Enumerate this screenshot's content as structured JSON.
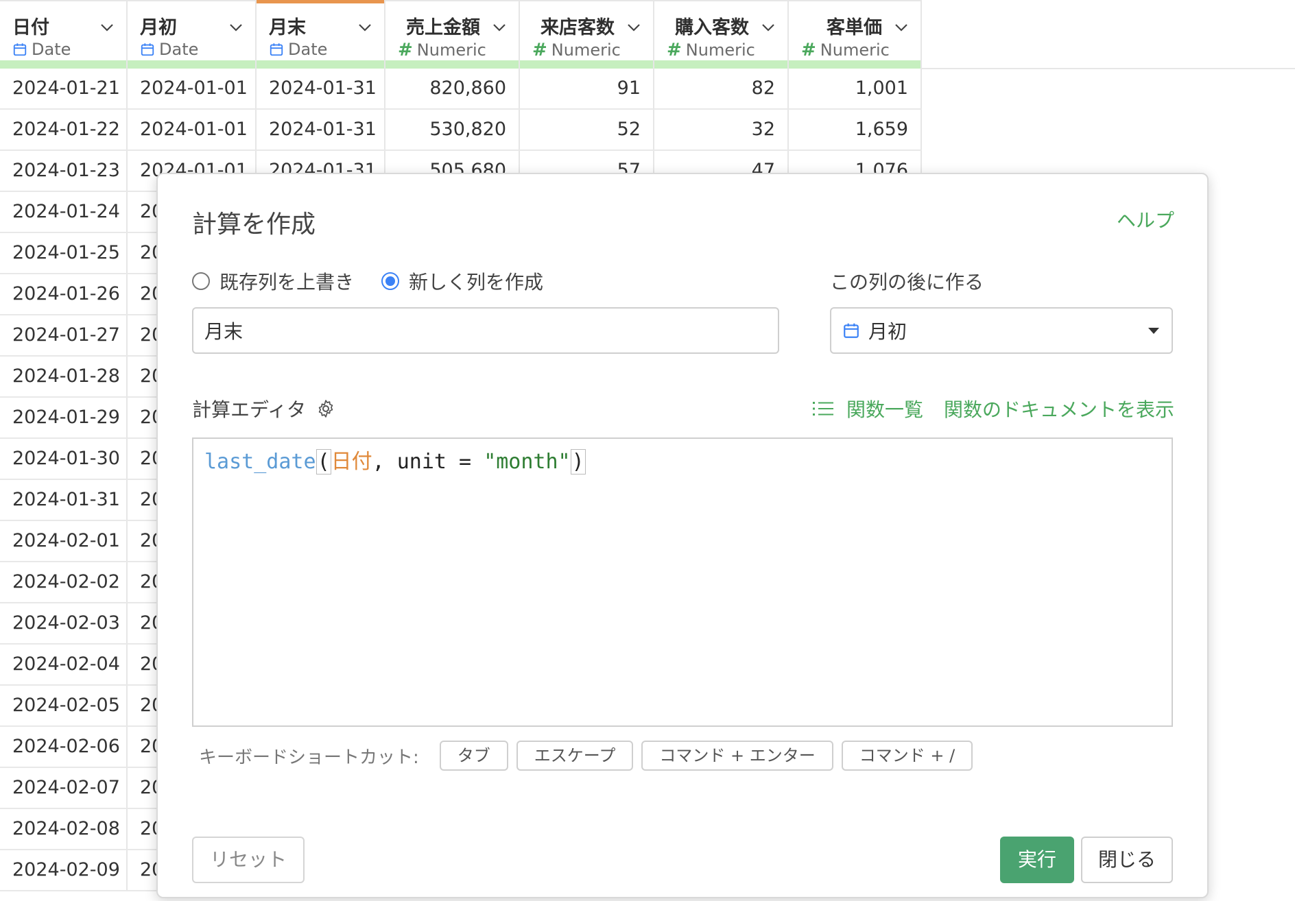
{
  "grid": {
    "columns": [
      {
        "name": "日付",
        "type": "Date",
        "kind": "date",
        "active": false
      },
      {
        "name": "月初",
        "type": "Date",
        "kind": "date",
        "active": false
      },
      {
        "name": "月末",
        "type": "Date",
        "kind": "date",
        "active": true
      },
      {
        "name": "売上金額",
        "type": "Numeric",
        "kind": "numeric",
        "active": false
      },
      {
        "name": "来店客数",
        "type": "Numeric",
        "kind": "numeric",
        "active": false
      },
      {
        "name": "購入客数",
        "type": "Numeric",
        "kind": "numeric",
        "active": false
      },
      {
        "name": "客単価",
        "type": "Numeric",
        "kind": "numeric",
        "active": false
      }
    ],
    "rows": [
      [
        "2024-01-21",
        "2024-01-01",
        "2024-01-31",
        "820,860",
        "91",
        "82",
        "1,001"
      ],
      [
        "2024-01-22",
        "2024-01-01",
        "2024-01-31",
        "530,820",
        "52",
        "32",
        "1,659"
      ],
      [
        "2024-01-23",
        "2024-01-01",
        "2024-01-31",
        "505,680",
        "57",
        "47",
        "1,076"
      ],
      [
        "2024-01-24",
        "20",
        "",
        "",
        "",
        "",
        ""
      ],
      [
        "2024-01-25",
        "20",
        "",
        "",
        "",
        "",
        ""
      ],
      [
        "2024-01-26",
        "20",
        "",
        "",
        "",
        "",
        ""
      ],
      [
        "2024-01-27",
        "20",
        "",
        "",
        "",
        "",
        ""
      ],
      [
        "2024-01-28",
        "20",
        "",
        "",
        "",
        "",
        ""
      ],
      [
        "2024-01-29",
        "20",
        "",
        "",
        "",
        "",
        ""
      ],
      [
        "2024-01-30",
        "20",
        "",
        "",
        "",
        "",
        ""
      ],
      [
        "2024-01-31",
        "20",
        "",
        "",
        "",
        "",
        ""
      ],
      [
        "2024-02-01",
        "20",
        "",
        "",
        "",
        "",
        ""
      ],
      [
        "2024-02-02",
        "20",
        "",
        "",
        "",
        "",
        ""
      ],
      [
        "2024-02-03",
        "20",
        "",
        "",
        "",
        "",
        ""
      ],
      [
        "2024-02-04",
        "20",
        "",
        "",
        "",
        "",
        ""
      ],
      [
        "2024-02-05",
        "20",
        "",
        "",
        "",
        "",
        ""
      ],
      [
        "2024-02-06",
        "20",
        "",
        "",
        "",
        "",
        ""
      ],
      [
        "2024-02-07",
        "20",
        "",
        "",
        "",
        "",
        ""
      ],
      [
        "2024-02-08",
        "20",
        "",
        "",
        "",
        "",
        ""
      ],
      [
        "2024-02-09",
        "20",
        "",
        "",
        "",
        "",
        ""
      ]
    ]
  },
  "dialog": {
    "title": "計算を作成",
    "help": "ヘルプ",
    "radio_overwrite": "既存列を上書き",
    "radio_new": "新しく列を作成",
    "selected_mode": "new",
    "column_name_value": "月末",
    "after_label": "この列の後に作る",
    "after_column": "月初",
    "editor_label": "計算エディタ",
    "function_list": "関数一覧",
    "function_docs": "関数のドキュメントを表示",
    "code": {
      "fn": "last_date",
      "open": "(",
      "col": "日付",
      "middle": ", unit = ",
      "str": "\"month\"",
      "close": ")"
    },
    "shortcuts_label": "キーボードショートカット:",
    "shortcuts": [
      "タブ",
      "エスケープ",
      "コマンド + エンター",
      "コマンド + /"
    ],
    "reset": "リセット",
    "run": "実行",
    "close": "閉じる"
  },
  "colors": {
    "accent_green": "#4aa85c",
    "run_button": "#4aa370",
    "active_column_bar": "#e8954e",
    "type_bar": "#c6efbf",
    "radio_selected": "#3b82f6"
  },
  "icons": {
    "date": "calendar-icon",
    "numeric": "hash-icon",
    "header_menu": "chevron-down-icon",
    "settings": "gear-icon",
    "function_list": "list-icon"
  }
}
